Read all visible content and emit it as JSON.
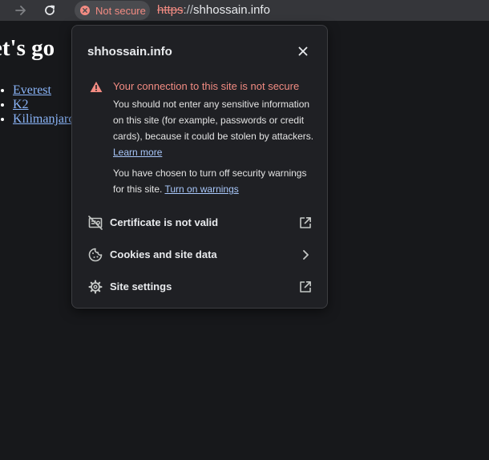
{
  "toolbar": {
    "back_icon": "arrow-forward-icon",
    "reload_icon": "reload-icon",
    "security_chip_label": "Not secure",
    "security_chip_icon": "error-circle-icon",
    "url_scheme": "https",
    "url_separator": "://",
    "url_host": "shhossain.info"
  },
  "page": {
    "heading": "et's go",
    "links": [
      "Everest",
      "K2",
      "Kilimanjaro"
    ]
  },
  "popup": {
    "title": "shhossain.info",
    "close_icon": "close-icon",
    "warning": {
      "icon": "warning-triangle-icon",
      "title": "Your connection to this site is not secure",
      "body": "You should not enter any sensitive information on this site (for example, passwords or credit cards), because it could be stolen by attackers.",
      "learn_more": "Learn more",
      "body2": "You have chosen to turn off security warnings for this site.",
      "turn_on_warnings": "Turn on warnings"
    },
    "rows": [
      {
        "label": "Certificate is not valid",
        "icon": "certificate-invalid-icon",
        "trail_icon": "open-external-icon"
      },
      {
        "label": "Cookies and site data",
        "icon": "cookie-icon",
        "trail_icon": "chevron-right-icon"
      },
      {
        "label": "Site settings",
        "icon": "gear-icon",
        "trail_icon": "open-external-icon"
      }
    ]
  },
  "colors": {
    "toolbar_bg": "#35363a",
    "page_bg": "#17181b",
    "popup_bg": "#1f2024",
    "danger": "#f28b82",
    "link": "#a8c7fa"
  }
}
